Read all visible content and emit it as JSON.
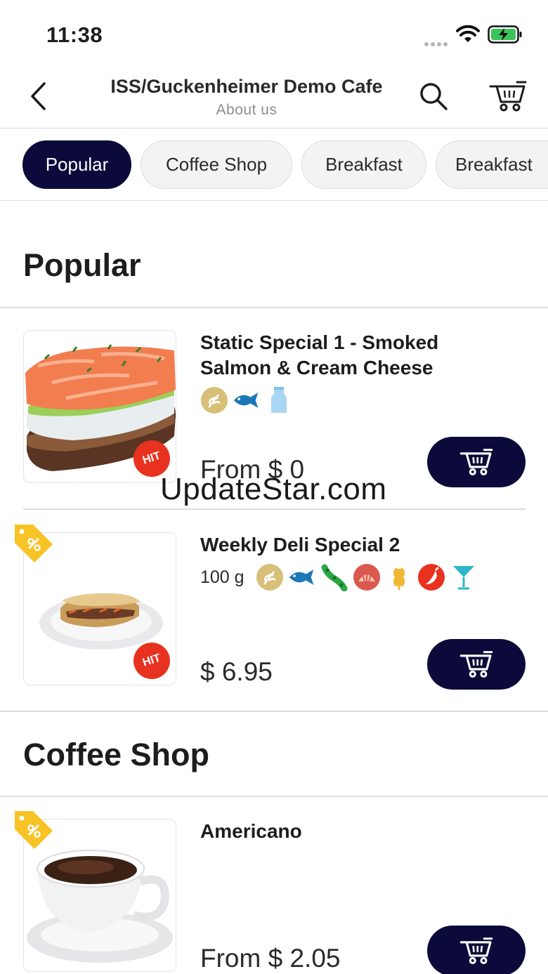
{
  "status": {
    "time": "11:38"
  },
  "header": {
    "title": "ISS/Guckenheimer Demo Cafe",
    "subtitle": "About us"
  },
  "tabs": [
    {
      "label": "Popular",
      "active": true
    },
    {
      "label": "Coffee Shop",
      "active": false
    },
    {
      "label": "Breakfast",
      "active": false
    },
    {
      "label": "Breakfast",
      "active": false
    }
  ],
  "sections": {
    "popular": {
      "title": "Popular",
      "items": [
        {
          "name": "Static Special 1 - Smoked Salmon & Cream Cheese",
          "weight": "",
          "price": "From $ 0",
          "badge": "HIT",
          "allergens": [
            "gluten-icon",
            "fish-icon",
            "milk-icon"
          ]
        },
        {
          "name": "Weekly Deli Special 2",
          "weight": "100 g",
          "price": "$ 6.95",
          "badge": "HIT",
          "allergens": [
            "gluten-icon",
            "fish-icon",
            "soy-icon",
            "shellfish-icon",
            "wheat-icon",
            "spicy-icon",
            "alcohol-icon"
          ]
        }
      ]
    },
    "coffee": {
      "title": "Coffee Shop",
      "items": [
        {
          "name": "Americano",
          "price": "From $ 2.05"
        }
      ]
    }
  },
  "watermark": "UpdateStar.com",
  "colors": {
    "accent": "#0b0a3a",
    "hit": "#e8321f",
    "tag": "#f7c325",
    "fish": "#1b78b8",
    "gluten": "#d8bf78"
  }
}
